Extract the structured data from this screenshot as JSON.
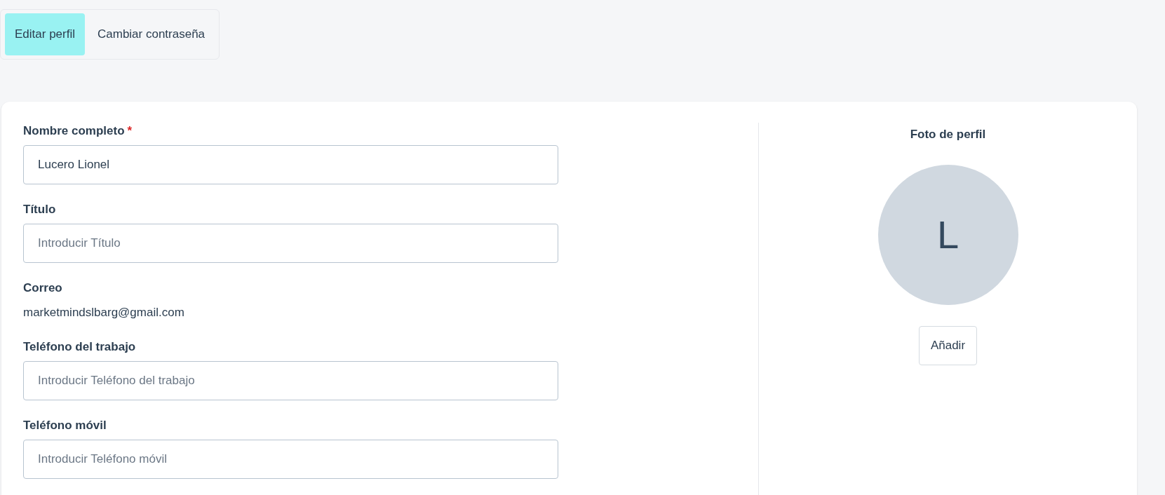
{
  "tabs": [
    {
      "label": "Editar perfil",
      "selected": true
    },
    {
      "label": "Cambiar contraseña",
      "selected": false
    }
  ],
  "form": {
    "fields": [
      {
        "kind": "input",
        "label": "Nombre completo",
        "required_mark": "*",
        "value": "Lucero Lionel"
      },
      {
        "kind": "input",
        "label": "Título",
        "placeholder": "Introducir Título"
      },
      {
        "kind": "text",
        "label": "Correo",
        "value": "marketmindslbarg@gmail.com"
      },
      {
        "kind": "input",
        "label": "Teléfono del trabajo",
        "placeholder": "Introducir Teléfono del trabajo"
      },
      {
        "kind": "input",
        "label": "Teléfono móvil",
        "placeholder": "Introducir Teléfono móvil"
      }
    ]
  },
  "photo": {
    "title": "Foto de perfil",
    "initial": "L",
    "button": "Añadir"
  }
}
